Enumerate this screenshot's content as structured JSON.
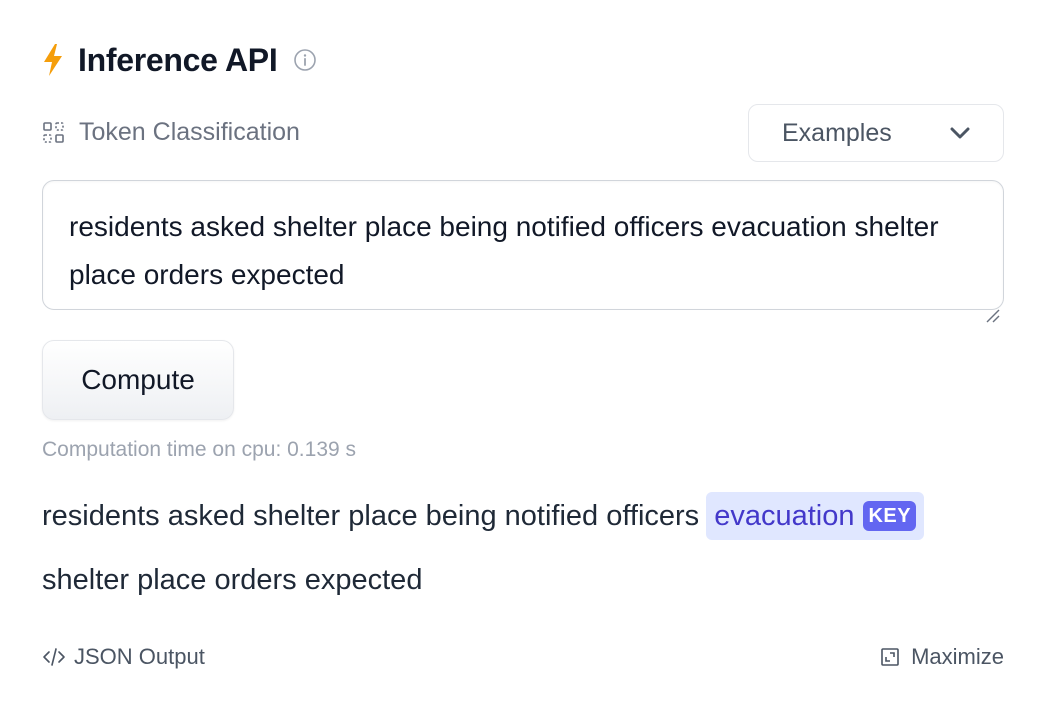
{
  "header": {
    "icon": "lightning-bolt-icon",
    "title": "Inference API",
    "info_icon": "info-circle-icon"
  },
  "task": {
    "icon": "token-classification-icon",
    "label": "Token Classification"
  },
  "examples": {
    "label": "Examples",
    "icon": "chevron-down-icon"
  },
  "input": {
    "value": "residents asked shelter place being notified officers evacuation shelter place orders expected"
  },
  "compute": {
    "label": "Compute"
  },
  "computation_time": "Computation time on cpu: 0.139 s",
  "result": {
    "line1_text": "residents asked shelter place being notified officers",
    "entity": {
      "text": "evacuation",
      "tag": "KEY"
    },
    "line2_text": "shelter place orders expected"
  },
  "footer": {
    "json_label": "JSON Output",
    "json_icon": "code-icon",
    "maximize_label": "Maximize",
    "maximize_icon": "maximize-icon"
  },
  "colors": {
    "accent": "#f59e0b",
    "entity_bg": "#e0e7ff",
    "entity_tag": "#6366f1",
    "muted": "#9ca3af"
  }
}
